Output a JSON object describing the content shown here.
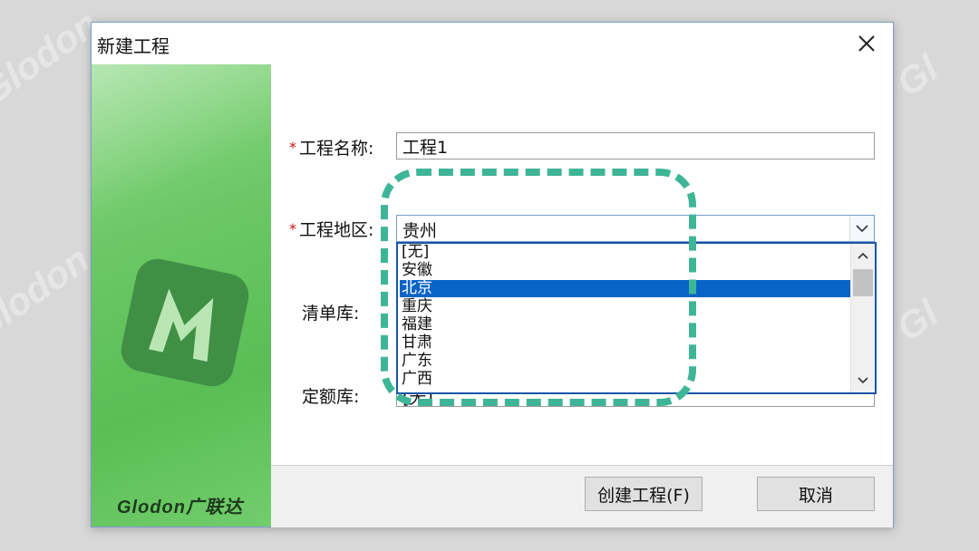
{
  "window": {
    "title": "新建工程"
  },
  "brand": {
    "name": "Glodon广联达",
    "logo_letter": "M"
  },
  "form": {
    "project_name": {
      "required_mark": "*",
      "label": "工程名称:",
      "value": "工程1"
    },
    "project_region": {
      "required_mark": "*",
      "label": "工程地区:",
      "value": "贵州",
      "options": [
        "[无]",
        "安徽",
        "北京",
        "重庆",
        "福建",
        "甘肃",
        "广东",
        "广西"
      ],
      "selected_index": 2
    },
    "bill_library": {
      "label": "清单库:"
    },
    "quota_library": {
      "label": "定额库:",
      "value": "[无]"
    }
  },
  "buttons": {
    "create": "创建工程(F)",
    "cancel": "取消"
  },
  "colors": {
    "highlight": "#3fb597",
    "selection": "#0a64c8",
    "sidebar_green": "#6cc866",
    "required": "#cc1111"
  },
  "icons": [
    "close-icon",
    "chevron-down-icon",
    "scroll-up-icon",
    "scroll-down-icon",
    "m-logo-icon"
  ]
}
